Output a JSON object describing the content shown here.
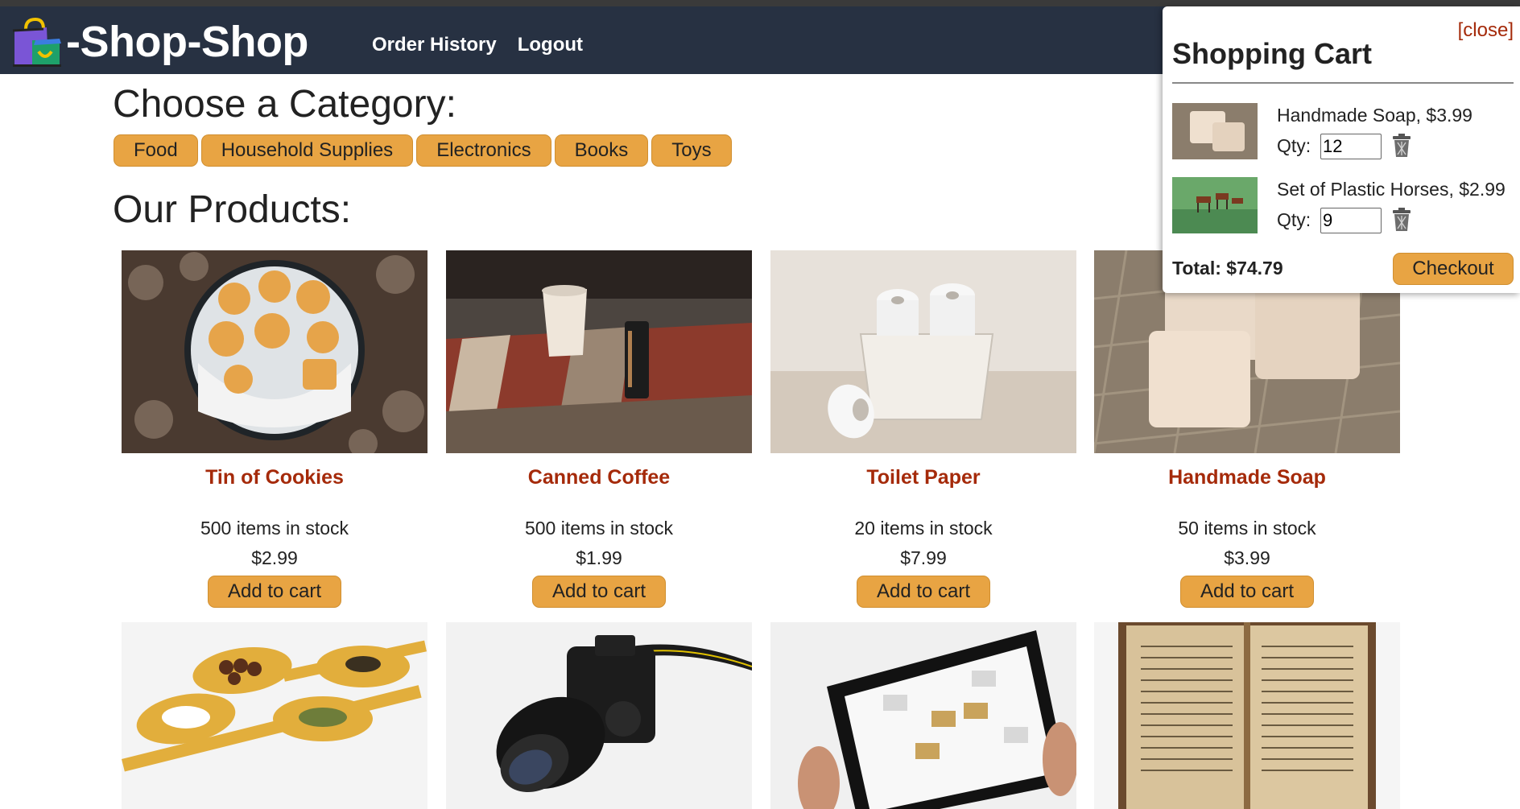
{
  "brand": {
    "name": "-Shop-Shop",
    "logo_icon": "shopping-bag-icon"
  },
  "nav": {
    "order_history": "Order History",
    "logout": "Logout"
  },
  "categories": {
    "title": "Choose a Category:",
    "items": [
      "Food",
      "Household Supplies",
      "Electronics",
      "Books",
      "Toys"
    ]
  },
  "products_title": "Our Products:",
  "products": [
    {
      "name": "Tin of Cookies",
      "stock": "500 items in stock",
      "price": "$2.99",
      "button": "Add to cart"
    },
    {
      "name": "Canned Coffee",
      "stock": "500 items in stock",
      "price": "$1.99",
      "button": "Add to cart"
    },
    {
      "name": "Toilet Paper",
      "stock": "20 items in stock",
      "price": "$7.99",
      "button": "Add to cart"
    },
    {
      "name": "Handmade Soap",
      "stock": "50 items in stock",
      "price": "$3.99",
      "button": "Add to cart"
    }
  ],
  "cart": {
    "close": "[close]",
    "title": "Shopping Cart",
    "qty_label": "Qty:",
    "items": [
      {
        "label": "Handmade Soap, $3.99",
        "qty": "12"
      },
      {
        "label": "Set of Plastic Horses, $2.99",
        "qty": "9"
      }
    ],
    "total": "Total: $74.79",
    "checkout": "Checkout"
  },
  "colors": {
    "navbar": "#273142",
    "accent": "#e8a443",
    "product_name": "#a52a0a"
  }
}
